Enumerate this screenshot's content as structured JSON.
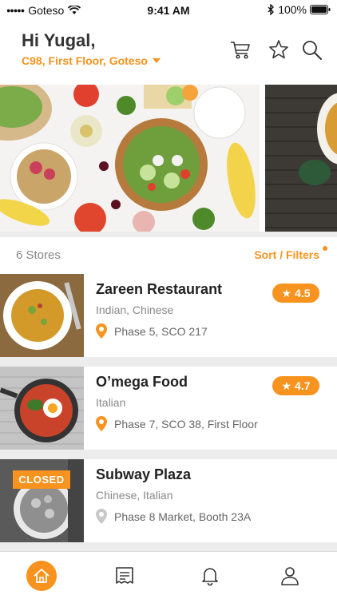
{
  "status_bar": {
    "carrier": "Goteso",
    "time": "9:41 AM",
    "battery": "100%"
  },
  "header": {
    "greeting": "Hi Yugal,",
    "location": "C98, First Floor, Goteso"
  },
  "list": {
    "store_count": "6 Stores",
    "sort_filters": "Sort / Filters"
  },
  "stores": [
    {
      "name": "Zareen Restaurant",
      "cuisine": "Indian, Chinese",
      "address": "Phase 5, SCO 217",
      "rating": "4.5"
    },
    {
      "name": "O’mega Food",
      "cuisine": "Italian",
      "address": "Phase 7, SCO 38, First Floor",
      "rating": "4.7"
    },
    {
      "name": "Subway Plaza",
      "cuisine": "Chinese, Italian",
      "address": "Phase 8 Market, Booth 23A",
      "status": "CLOSED"
    }
  ],
  "colors": {
    "accent": "#f7931e",
    "muted_pin": "#c8c8c8"
  },
  "icons": [
    "wifi-icon",
    "bluetooth-icon",
    "battery-icon",
    "cart-icon",
    "star-icon",
    "search-icon",
    "location-pin-icon",
    "home-icon",
    "receipt-icon",
    "bell-icon",
    "user-icon"
  ]
}
